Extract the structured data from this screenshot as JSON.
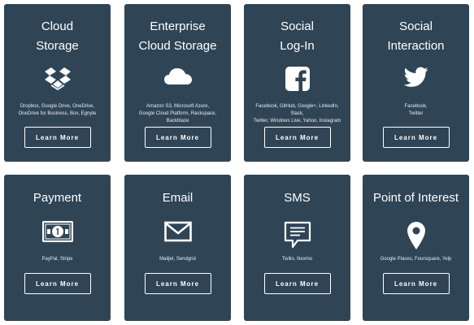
{
  "colors": {
    "card_bg": "#2f4556",
    "text": "#ffffff"
  },
  "cards": [
    {
      "title_lines": [
        "Cloud",
        "Storage"
      ],
      "icon": "dropbox-icon",
      "description": [
        "Dropbox, Google Drive, OneDrive,",
        "OneDrive for Business, Box, Egnyte"
      ],
      "button": "Learn More"
    },
    {
      "title_lines": [
        "Enterprise",
        "Cloud Storage"
      ],
      "icon": "cloud-icon",
      "description": [
        "Amazon S3, Microsoft Azure,",
        "Google Cloud Platform, Rackspace, Backblaze"
      ],
      "button": "Learn More"
    },
    {
      "title_lines": [
        "Social",
        "Log-In"
      ],
      "icon": "facebook-icon",
      "description": [
        "Facebook, GitHub, Google+, LinkedIn, Slack,",
        "Twitter, Windows Live, Yahoo, Instagram"
      ],
      "button": "Learn More"
    },
    {
      "title_lines": [
        "Social",
        "Interaction"
      ],
      "icon": "twitter-icon",
      "description": [
        "Facebook,",
        "Twitter"
      ],
      "button": "Learn More"
    },
    {
      "title_lines": [
        "Payment"
      ],
      "icon": "banknote-icon",
      "description": [
        "PayPal, Stripe"
      ],
      "button": "Learn More"
    },
    {
      "title_lines": [
        "Email"
      ],
      "icon": "envelope-icon",
      "description": [
        "Mailjet, Sendgrid"
      ],
      "button": "Learn More"
    },
    {
      "title_lines": [
        "SMS"
      ],
      "icon": "chat-bubble-icon",
      "description": [
        "Twilio, Nexmo"
      ],
      "button": "Learn More"
    },
    {
      "title_lines": [
        "Point of Interest"
      ],
      "icon": "map-pin-icon",
      "description": [
        "Google Places, Foursquare, Yelp"
      ],
      "button": "Learn More"
    }
  ]
}
